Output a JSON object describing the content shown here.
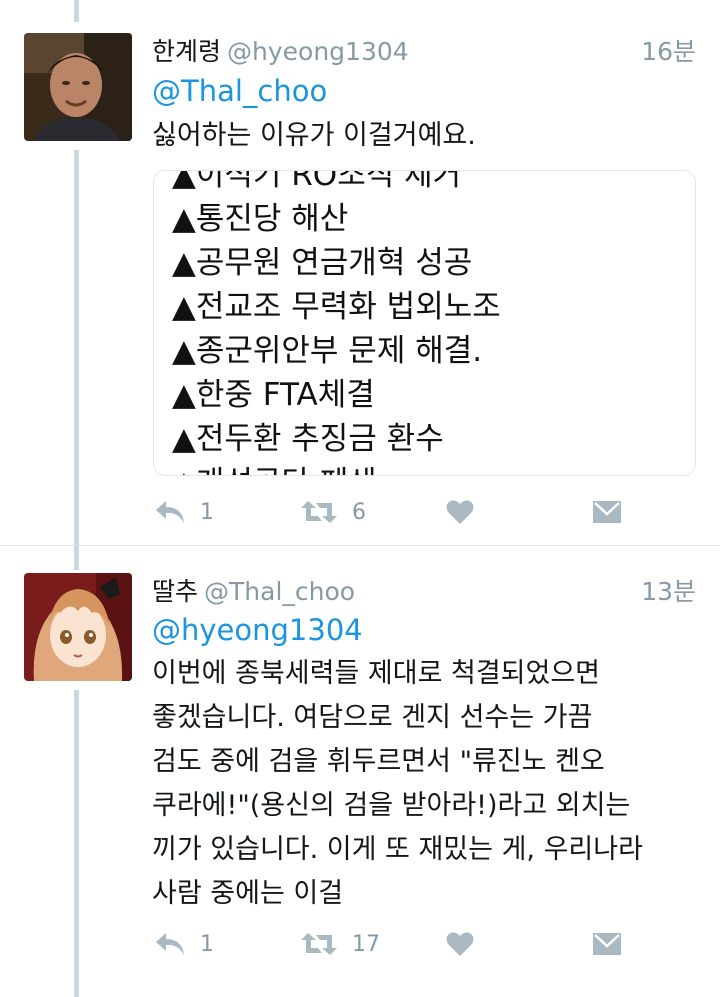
{
  "tweets": [
    {
      "display_name": "한계령",
      "handle": "@hyeong1304",
      "time": "16분",
      "mention": "@Thal_choo",
      "text_lines": [
        "싫어하는 이유가 이걸거예요."
      ],
      "media_lines": [
        "▲이석기 RO조직 제거",
        "▲통진당 해산",
        "▲공무원 연금개혁 성공",
        "▲전교조 무력화 법외노조",
        "▲종군위안부 문제 해결.",
        "▲한중 FTA체결",
        "▲전두환 추징금 환수",
        "▲개성공단 폐쇄"
      ],
      "reply_count": "1",
      "retweet_count": "6",
      "like_count": "",
      "avatar_icon": "avatar-photo-man"
    },
    {
      "display_name": "딸추",
      "handle": "@Thal_choo",
      "time": "13분",
      "mention": "@hyeong1304",
      "text_lines": [
        "이번에 종북세력들 제대로 척결되었으면",
        "좋겠습니다. 여담으로 겐지 선수는 가끔",
        "검도 중에 검을 휘두르면서 \"류진노 켄오",
        "쿠라에!\"(용신의 검을 받아라!)라고 외치는",
        "끼가 있습니다. 이게 또 재밌는 게, 우리나라",
        "사람 중에는 이걸"
      ],
      "reply_count": "1",
      "retweet_count": "17",
      "like_count": "",
      "avatar_icon": "avatar-anime-girl"
    }
  ],
  "icons": {
    "reply": "reply-icon",
    "retweet": "retweet-icon",
    "like": "heart-icon",
    "dm": "envelope-icon"
  },
  "colors": {
    "link": "#1b95e0",
    "muted": "#8899a6",
    "icon": "#aab8c2",
    "thread_line": "#ccd6dd"
  }
}
